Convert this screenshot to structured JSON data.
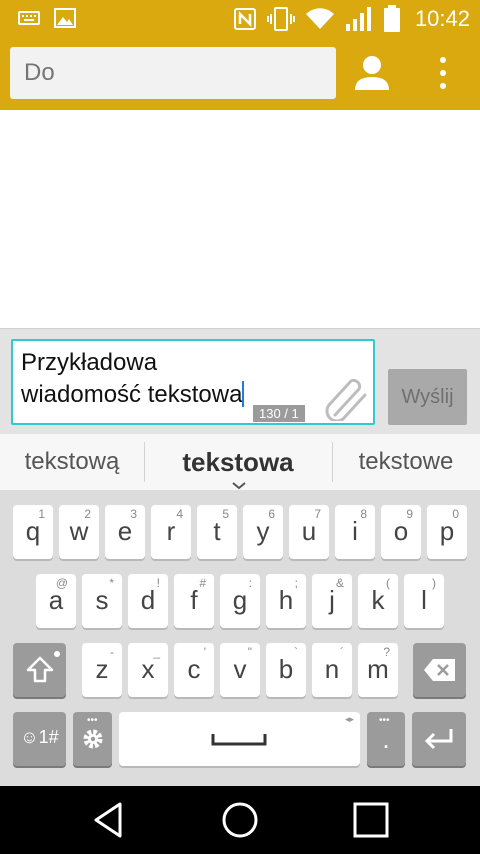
{
  "status_bar": {
    "time": "10:42",
    "icons": [
      "keyboard-icon",
      "image-icon",
      "nfc-icon",
      "vibrate-icon",
      "wifi-icon",
      "signal-icon",
      "battery-icon"
    ]
  },
  "recipient": {
    "placeholder": "Do",
    "contact_icon": "contact-icon",
    "menu_icon": "overflow-menu-icon"
  },
  "compose": {
    "text_line1": "Przykładowa",
    "text_line2": "wiadomość tekstowa",
    "counter": "130 / 1",
    "attach_icon": "paperclip-icon",
    "send_label": "Wyślij"
  },
  "suggestions": [
    "tekstową",
    "tekstowa",
    "tekstowe"
  ],
  "keyboard": {
    "row1": [
      {
        "key": "q",
        "hint": "1"
      },
      {
        "key": "w",
        "hint": "2"
      },
      {
        "key": "e",
        "hint": "3"
      },
      {
        "key": "r",
        "hint": "4"
      },
      {
        "key": "t",
        "hint": "5"
      },
      {
        "key": "y",
        "hint": "6"
      },
      {
        "key": "u",
        "hint": "7"
      },
      {
        "key": "i",
        "hint": "8"
      },
      {
        "key": "o",
        "hint": "9"
      },
      {
        "key": "p",
        "hint": "0"
      }
    ],
    "row2": [
      {
        "key": "a",
        "hint": "@"
      },
      {
        "key": "s",
        "hint": "*"
      },
      {
        "key": "d",
        "hint": "!"
      },
      {
        "key": "f",
        "hint": "#"
      },
      {
        "key": "g",
        "hint": ":"
      },
      {
        "key": "h",
        "hint": ";"
      },
      {
        "key": "j",
        "hint": "&"
      },
      {
        "key": "k",
        "hint": "("
      },
      {
        "key": "l",
        "hint": ")"
      }
    ],
    "row3": [
      {
        "key": "z",
        "hint": "-"
      },
      {
        "key": "x",
        "hint": "_"
      },
      {
        "key": "c",
        "hint": "'"
      },
      {
        "key": "v",
        "hint": "\""
      },
      {
        "key": "b",
        "hint": "`"
      },
      {
        "key": "n",
        "hint": "´"
      },
      {
        "key": "m",
        "hint": "?"
      }
    ],
    "symbols_label": "☺1#",
    "period": ".",
    "shift_icon": "shift-icon",
    "backspace_icon": "backspace-icon",
    "settings_icon": "gear-icon",
    "space_icon": "space-bar-icon",
    "enter_icon": "enter-icon"
  },
  "colors": {
    "accent": "#d9a90f",
    "compose_border": "#2ec9d2",
    "send_bg": "#a9a9a9"
  },
  "nav_bar": [
    "back-icon",
    "home-icon",
    "recents-icon"
  ]
}
